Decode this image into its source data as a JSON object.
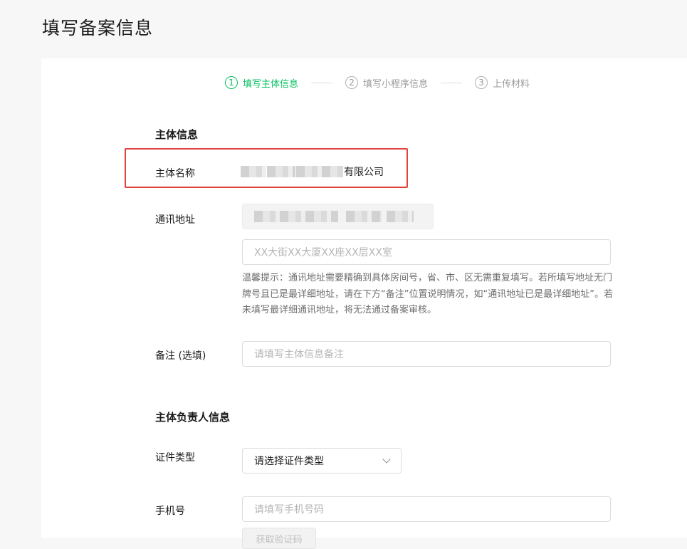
{
  "page": {
    "title": "填写备案信息"
  },
  "steps": [
    {
      "num": "1",
      "label": "填写主体信息",
      "active": true
    },
    {
      "num": "2",
      "label": "填写小程序信息",
      "active": false
    },
    {
      "num": "3",
      "label": "上传材料",
      "active": false
    }
  ],
  "subject_info": {
    "section_title": "主体信息",
    "name_label": "主体名称",
    "name_suffix": "有限公司",
    "address_label": "通讯地址",
    "address_placeholder": "XX大街XX大厦XX座XX层XX室",
    "address_tip": "温馨提示：通讯地址需要精确到具体房间号，省、市、区无需重复填写。若所填写地址无门牌号且已是最详细地址，请在下方“备注”位置说明情况，如“通讯地址已是最详细地址”。若未填写最详细通讯地址，将无法通过备案审核。",
    "remark_label": "备注 (选填)",
    "remark_placeholder": "请填写主体信息备注"
  },
  "owner_info": {
    "section_title": "主体负责人信息",
    "id_type_label": "证件类型",
    "id_type_value": "请选择证件类型",
    "phone_label": "手机号",
    "phone_placeholder": "请填写手机号码",
    "verify_button": "获取验证码"
  },
  "colors": {
    "accent": "#07c160",
    "highlight": "#e0413c"
  }
}
